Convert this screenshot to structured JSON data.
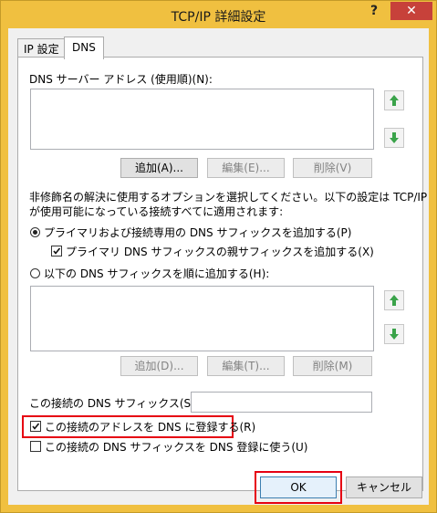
{
  "window": {
    "title": "TCP/IP 詳細設定",
    "help_label": "?",
    "close_label": "✕"
  },
  "tabs": [
    {
      "label": "IP 設定"
    },
    {
      "label": "DNS"
    }
  ],
  "dns": {
    "servers_label": "DNS サーバー アドレス (使用順)(N):",
    "servers": [],
    "add_label": "追加(A)...",
    "edit_label": "編集(E)...",
    "remove_label": "削除(V)",
    "description": "非修飾名の解決に使用するオプションを選択してください。以下の設定は TCP/IP",
    "description2": "が使用可能になっている接続すべてに適用されます:",
    "radio_primary_label": "プライマリおよび接続専用の DNS サフィックスを追加する(P)",
    "radio_primary_checked": true,
    "parent_suffix_label": "プライマリ DNS サフィックスの親サフィックスを追加する(X)",
    "parent_suffix_checked": true,
    "radio_append_label": "以下の DNS サフィックスを順に追加する(H):",
    "radio_append_checked": false,
    "suffixes": [],
    "suffix_add_label": "追加(D)...",
    "suffix_edit_label": "編集(T)...",
    "suffix_remove_label": "削除(M)",
    "connection_suffix_label": "この接続の DNS サフィックス(S):",
    "connection_suffix_value": "",
    "register_label": "この接続のアドレスを DNS に登録する(R)",
    "register_checked": true,
    "use_suffix_label": "この接続の DNS サフィックスを DNS 登録に使う(U)",
    "use_suffix_checked": false
  },
  "footer": {
    "ok_label": "OK",
    "cancel_label": "キャンセル"
  },
  "colors": {
    "titlebar": "#f0c040",
    "close": "#c7413a",
    "highlight": "#e60012",
    "arrow": "#3aa34a"
  }
}
